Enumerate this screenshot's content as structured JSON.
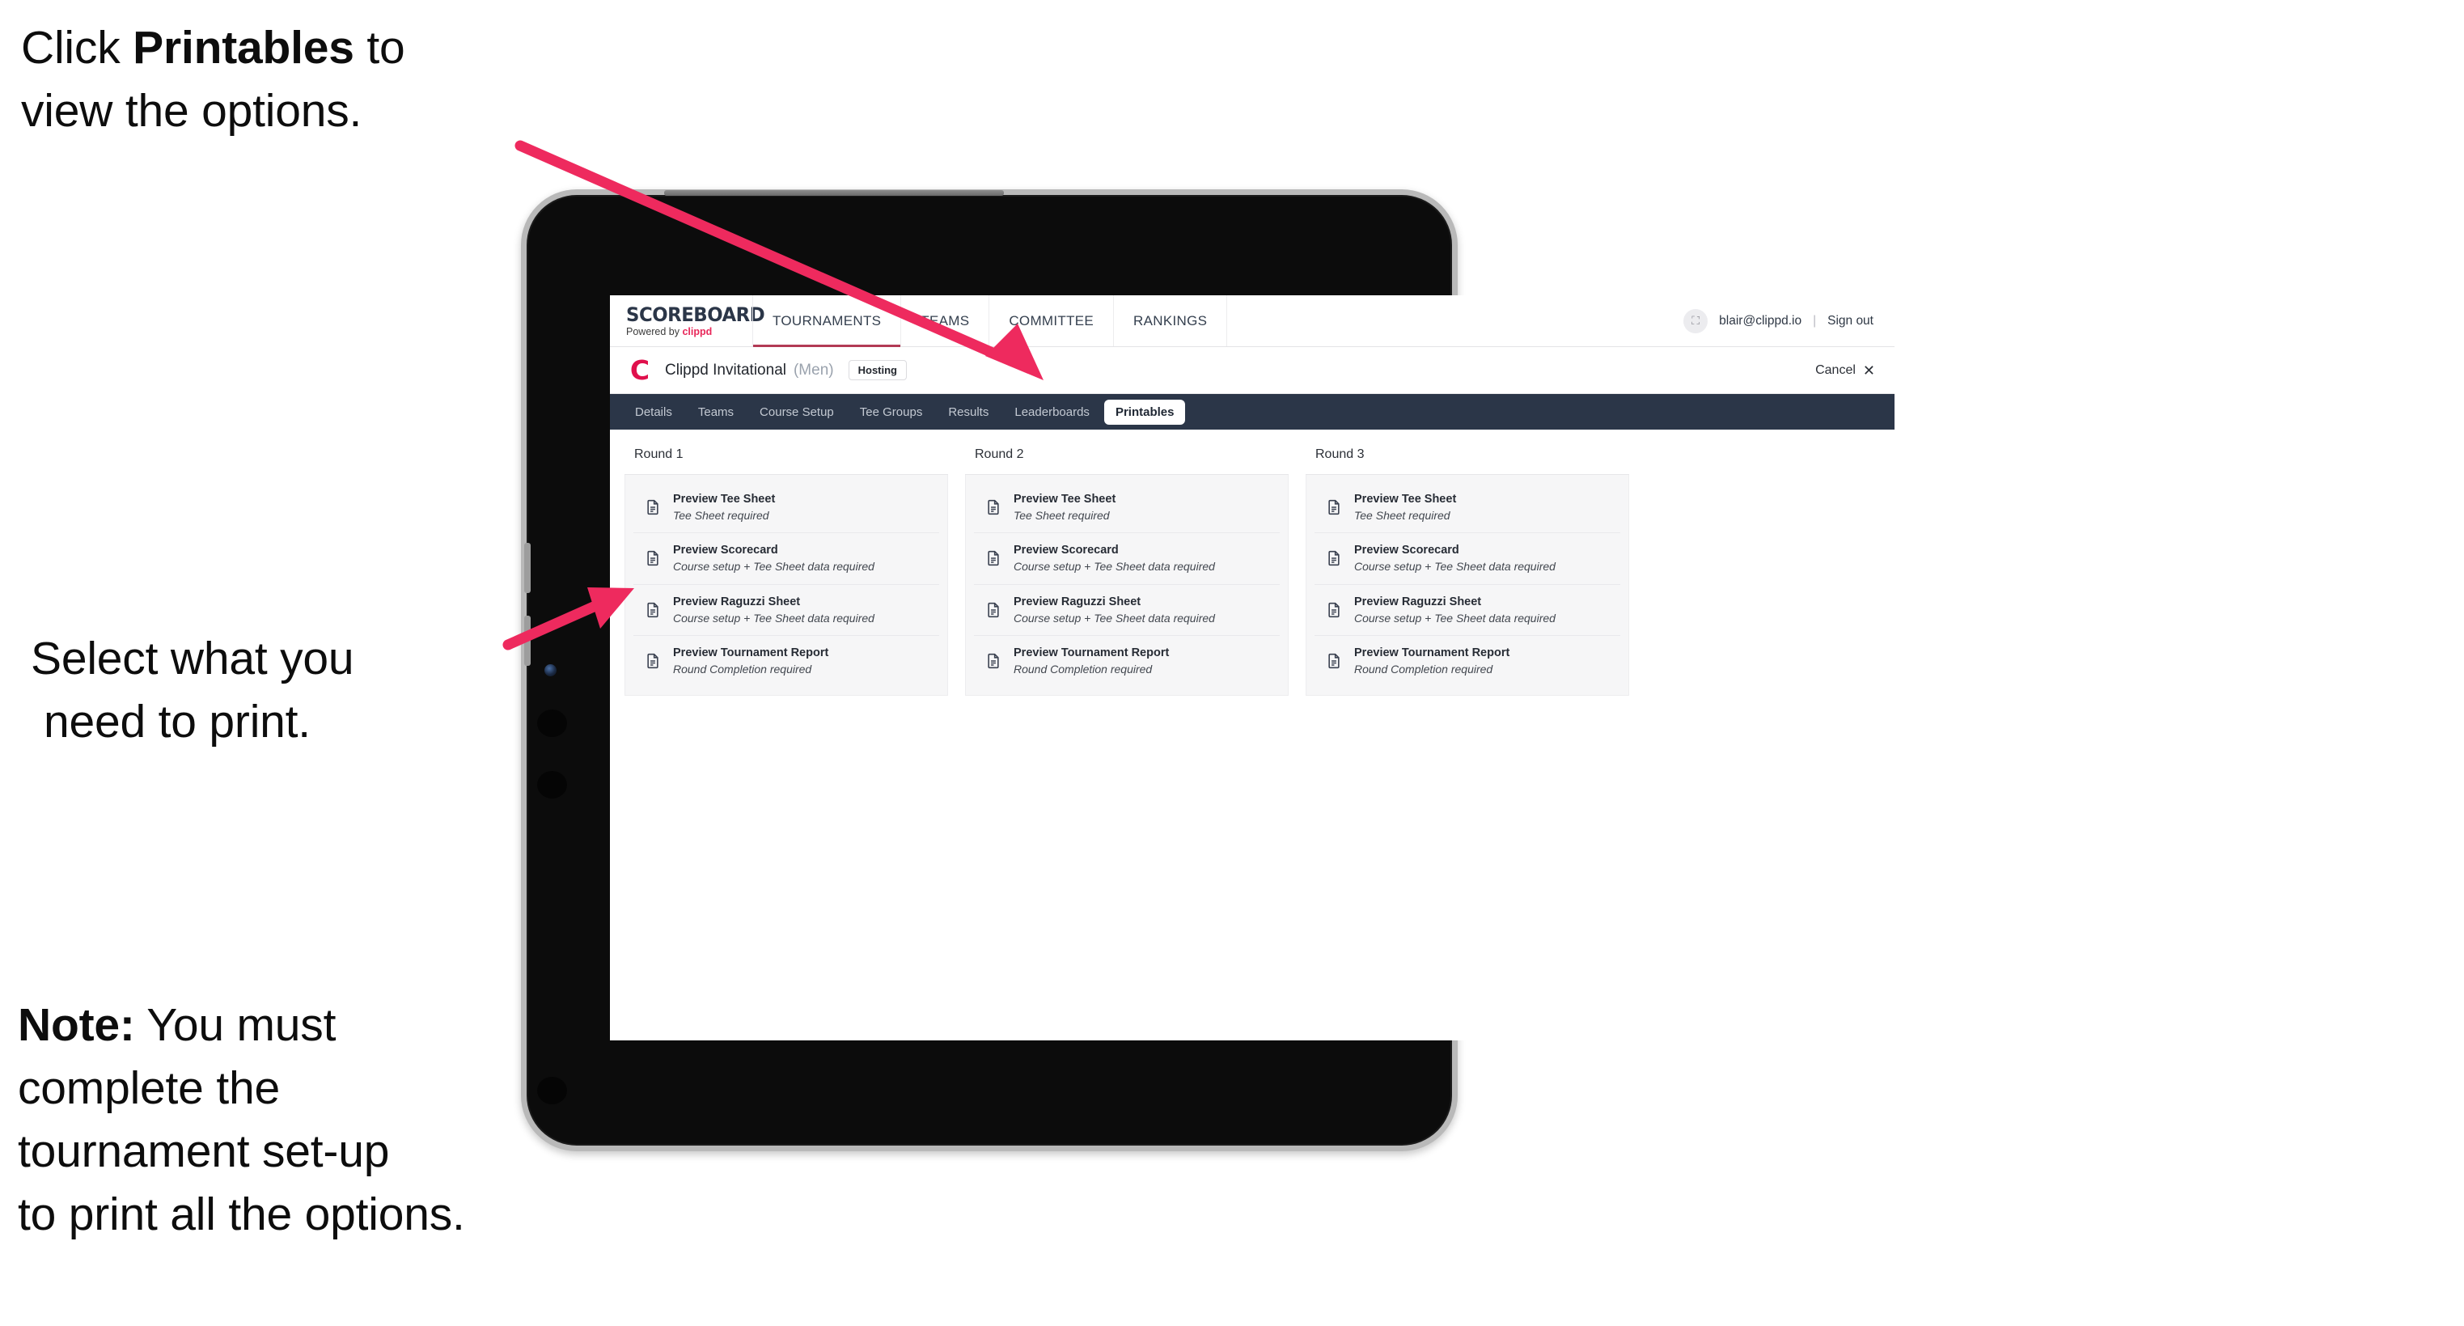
{
  "annotations": {
    "click_instruction": {
      "before": "Click ",
      "bold": "Printables",
      "after": " to",
      "line2": "view the options."
    },
    "select_instruction": {
      "line1": "Select what you",
      "line2": "need to print."
    },
    "note": {
      "label": "Note:",
      "line1": " You must",
      "line2": "complete the",
      "line3": "tournament set-up",
      "line4": "to print all the options."
    }
  },
  "colors": {
    "arrow_pink": "#ee2a5e",
    "tabstrip_navy": "#2b3648",
    "brand_pink": "#e8285a",
    "tournament_logo_pink": "#e0104c"
  },
  "app": {
    "logo": {
      "wordmark": "SCOREBOARD",
      "tagline_prefix": "Powered by ",
      "tagline_brand": "clippd"
    },
    "top_nav": [
      {
        "label": "TOURNAMENTS",
        "active": true
      },
      {
        "label": "TEAMS",
        "active": false
      },
      {
        "label": "COMMITTEE",
        "active": false
      },
      {
        "label": "RANKINGS",
        "active": false
      }
    ],
    "account": {
      "avatar_glyph": "⛶",
      "email": "blair@clippd.io",
      "separator": "|",
      "sign_out": "Sign out"
    },
    "tournament_header": {
      "logo_letter": "C",
      "name": "Clippd Invitational",
      "gender": "(Men)",
      "status_badge": "Hosting",
      "cancel_label": "Cancel",
      "cancel_icon": "✕"
    },
    "tabs": [
      {
        "label": "Details",
        "active": false
      },
      {
        "label": "Teams",
        "active": false
      },
      {
        "label": "Course Setup",
        "active": false
      },
      {
        "label": "Tee Groups",
        "active": false
      },
      {
        "label": "Results",
        "active": false
      },
      {
        "label": "Leaderboards",
        "active": false
      },
      {
        "label": "Printables",
        "active": true
      }
    ],
    "rounds": [
      {
        "title": "Round 1",
        "items": [
          {
            "title": "Preview Tee Sheet",
            "subtitle": "Tee Sheet required"
          },
          {
            "title": "Preview Scorecard",
            "subtitle": "Course setup + Tee Sheet data required"
          },
          {
            "title": "Preview Raguzzi Sheet",
            "subtitle": "Course setup + Tee Sheet data required"
          },
          {
            "title": "Preview Tournament Report",
            "subtitle": "Round Completion required"
          }
        ]
      },
      {
        "title": "Round 2",
        "items": [
          {
            "title": "Preview Tee Sheet",
            "subtitle": "Tee Sheet required"
          },
          {
            "title": "Preview Scorecard",
            "subtitle": "Course setup + Tee Sheet data required"
          },
          {
            "title": "Preview Raguzzi Sheet",
            "subtitle": "Course setup + Tee Sheet data required"
          },
          {
            "title": "Preview Tournament Report",
            "subtitle": "Round Completion required"
          }
        ]
      },
      {
        "title": "Round 3",
        "items": [
          {
            "title": "Preview Tee Sheet",
            "subtitle": "Tee Sheet required"
          },
          {
            "title": "Preview Scorecard",
            "subtitle": "Course setup + Tee Sheet data required"
          },
          {
            "title": "Preview Raguzzi Sheet",
            "subtitle": "Course setup + Tee Sheet data required"
          },
          {
            "title": "Preview Tournament Report",
            "subtitle": "Round Completion required"
          }
        ]
      }
    ]
  }
}
